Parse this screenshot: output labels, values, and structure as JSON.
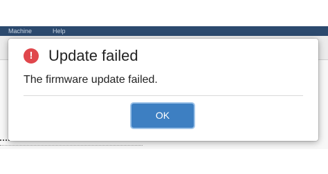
{
  "background_app": {
    "menubar": {
      "items": [
        "Machine",
        "Help"
      ]
    }
  },
  "dialog": {
    "icon": "error-circle-icon",
    "icon_glyph": "!",
    "title": "Update failed",
    "message": "The firmware update failed.",
    "ok_label": "OK"
  },
  "colors": {
    "error_icon": "#e0474c",
    "primary_button": "#3d7fc2",
    "menubar_bg": "#2c4a6e"
  }
}
